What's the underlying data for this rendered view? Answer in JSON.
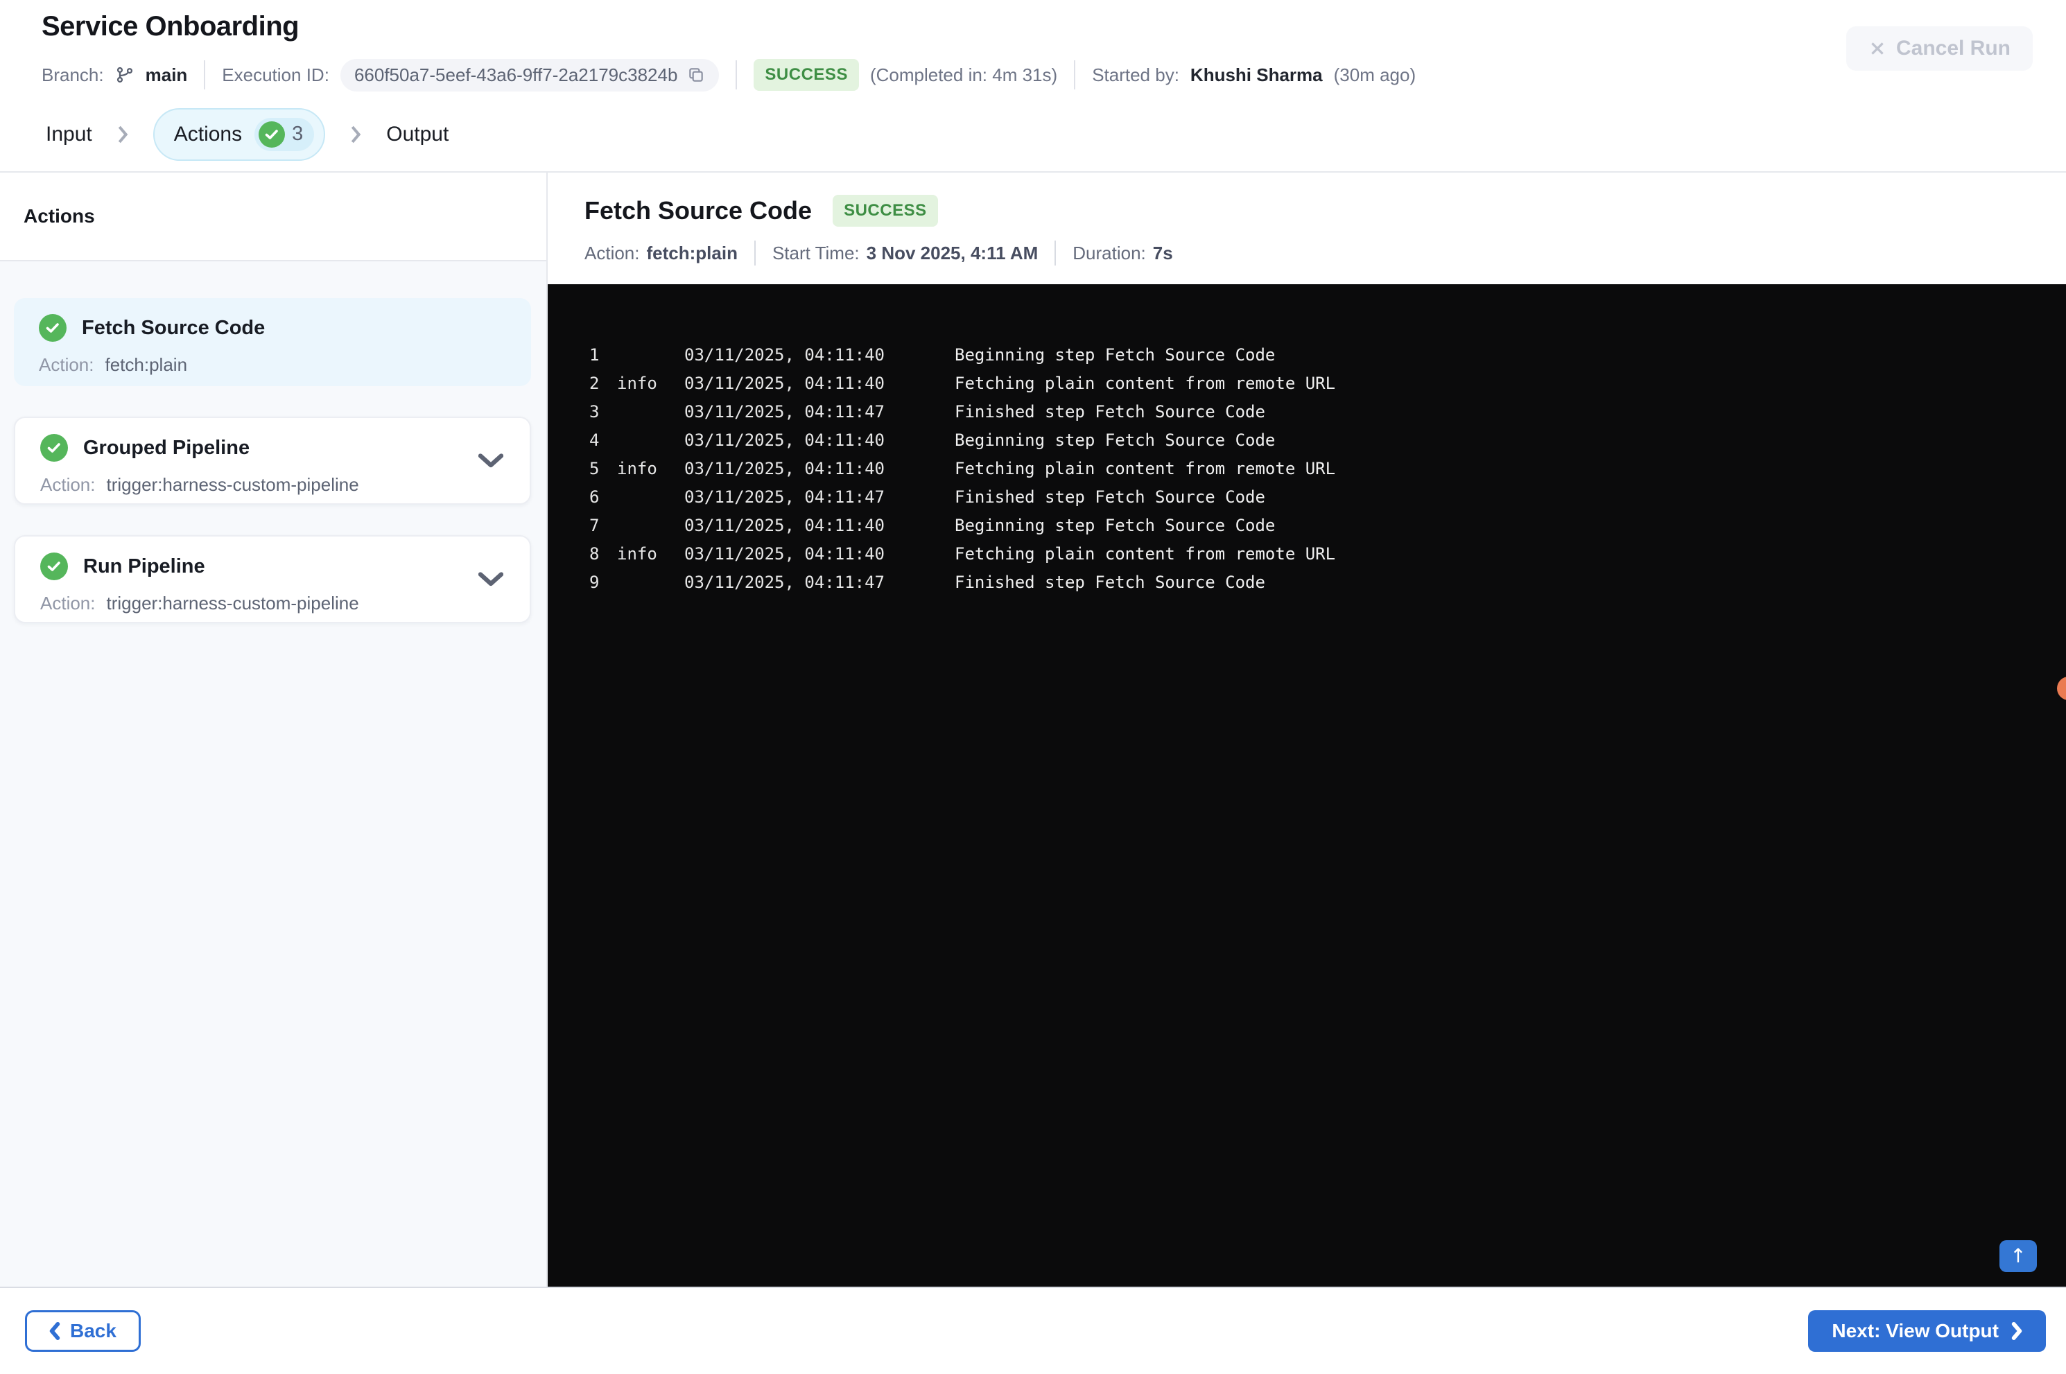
{
  "header": {
    "title": "Service Onboarding",
    "branch_label": "Branch:",
    "branch_name": "main",
    "execution_id_label": "Execution ID:",
    "execution_id": "660f50a7-5eef-43a6-9ff7-2a2179c3824b",
    "status": "SUCCESS",
    "completed_in": "(Completed in: 4m 31s)",
    "started_by_label": "Started by:",
    "started_by": "Khushi Sharma",
    "started_ago": "(30m ago)",
    "cancel_button": "Cancel Run"
  },
  "tabs": {
    "items": [
      {
        "label": "Input",
        "active": false
      },
      {
        "label": "Actions",
        "active": true,
        "count": "3"
      },
      {
        "label": "Output",
        "active": false
      }
    ]
  },
  "sidebar": {
    "heading": "Actions",
    "action_label": "Action:",
    "items": [
      {
        "title": "Fetch Source Code",
        "action": "fetch:plain",
        "status": "success",
        "selected": true,
        "expandable": false
      },
      {
        "title": "Grouped Pipeline",
        "action": "trigger:harness-custom-pipeline",
        "status": "success",
        "selected": false,
        "expandable": true
      },
      {
        "title": "Run Pipeline",
        "action": "trigger:harness-custom-pipeline",
        "status": "success",
        "selected": false,
        "expandable": true
      }
    ]
  },
  "detail": {
    "title": "Fetch Source Code",
    "status": "SUCCESS",
    "meta": [
      {
        "label": "Action:",
        "value": "fetch:plain"
      },
      {
        "label": "Start Time:",
        "value": "3 Nov 2025, 4:11 AM"
      },
      {
        "label": "Duration:",
        "value": "7s"
      }
    ]
  },
  "log": {
    "lines": [
      {
        "num": "1",
        "level": "",
        "time": "03/11/2025, 04:11:40",
        "message": "Beginning step Fetch Source Code"
      },
      {
        "num": "2",
        "level": "info",
        "time": "03/11/2025, 04:11:40",
        "message": "Fetching plain content from remote URL"
      },
      {
        "num": "3",
        "level": "",
        "time": "03/11/2025, 04:11:47",
        "message": "Finished step Fetch Source Code"
      },
      {
        "num": "4",
        "level": "",
        "time": "03/11/2025, 04:11:40",
        "message": "Beginning step Fetch Source Code"
      },
      {
        "num": "5",
        "level": "info",
        "time": "03/11/2025, 04:11:40",
        "message": "Fetching plain content from remote URL"
      },
      {
        "num": "6",
        "level": "",
        "time": "03/11/2025, 04:11:47",
        "message": "Finished step Fetch Source Code"
      },
      {
        "num": "7",
        "level": "",
        "time": "03/11/2025, 04:11:40",
        "message": "Beginning step Fetch Source Code"
      },
      {
        "num": "8",
        "level": "info",
        "time": "03/11/2025, 04:11:40",
        "message": "Fetching plain content from remote URL"
      },
      {
        "num": "9",
        "level": "",
        "time": "03/11/2025, 04:11:47",
        "message": "Finished step Fetch Source Code"
      }
    ]
  },
  "footer": {
    "back_button": "Back",
    "next_button": "Next: View Output"
  },
  "colors": {
    "accent_blue": "#2f6fd4",
    "success_green": "#55b65b",
    "success_badge_bg": "#e3f3df",
    "success_badge_text": "#3e8e44",
    "tab_pill_bg": "#e9f7fd",
    "selected_card_bg": "#ebf6fd",
    "console_bg": "#0b0b0c",
    "notification_dot": "#ea7b52"
  }
}
